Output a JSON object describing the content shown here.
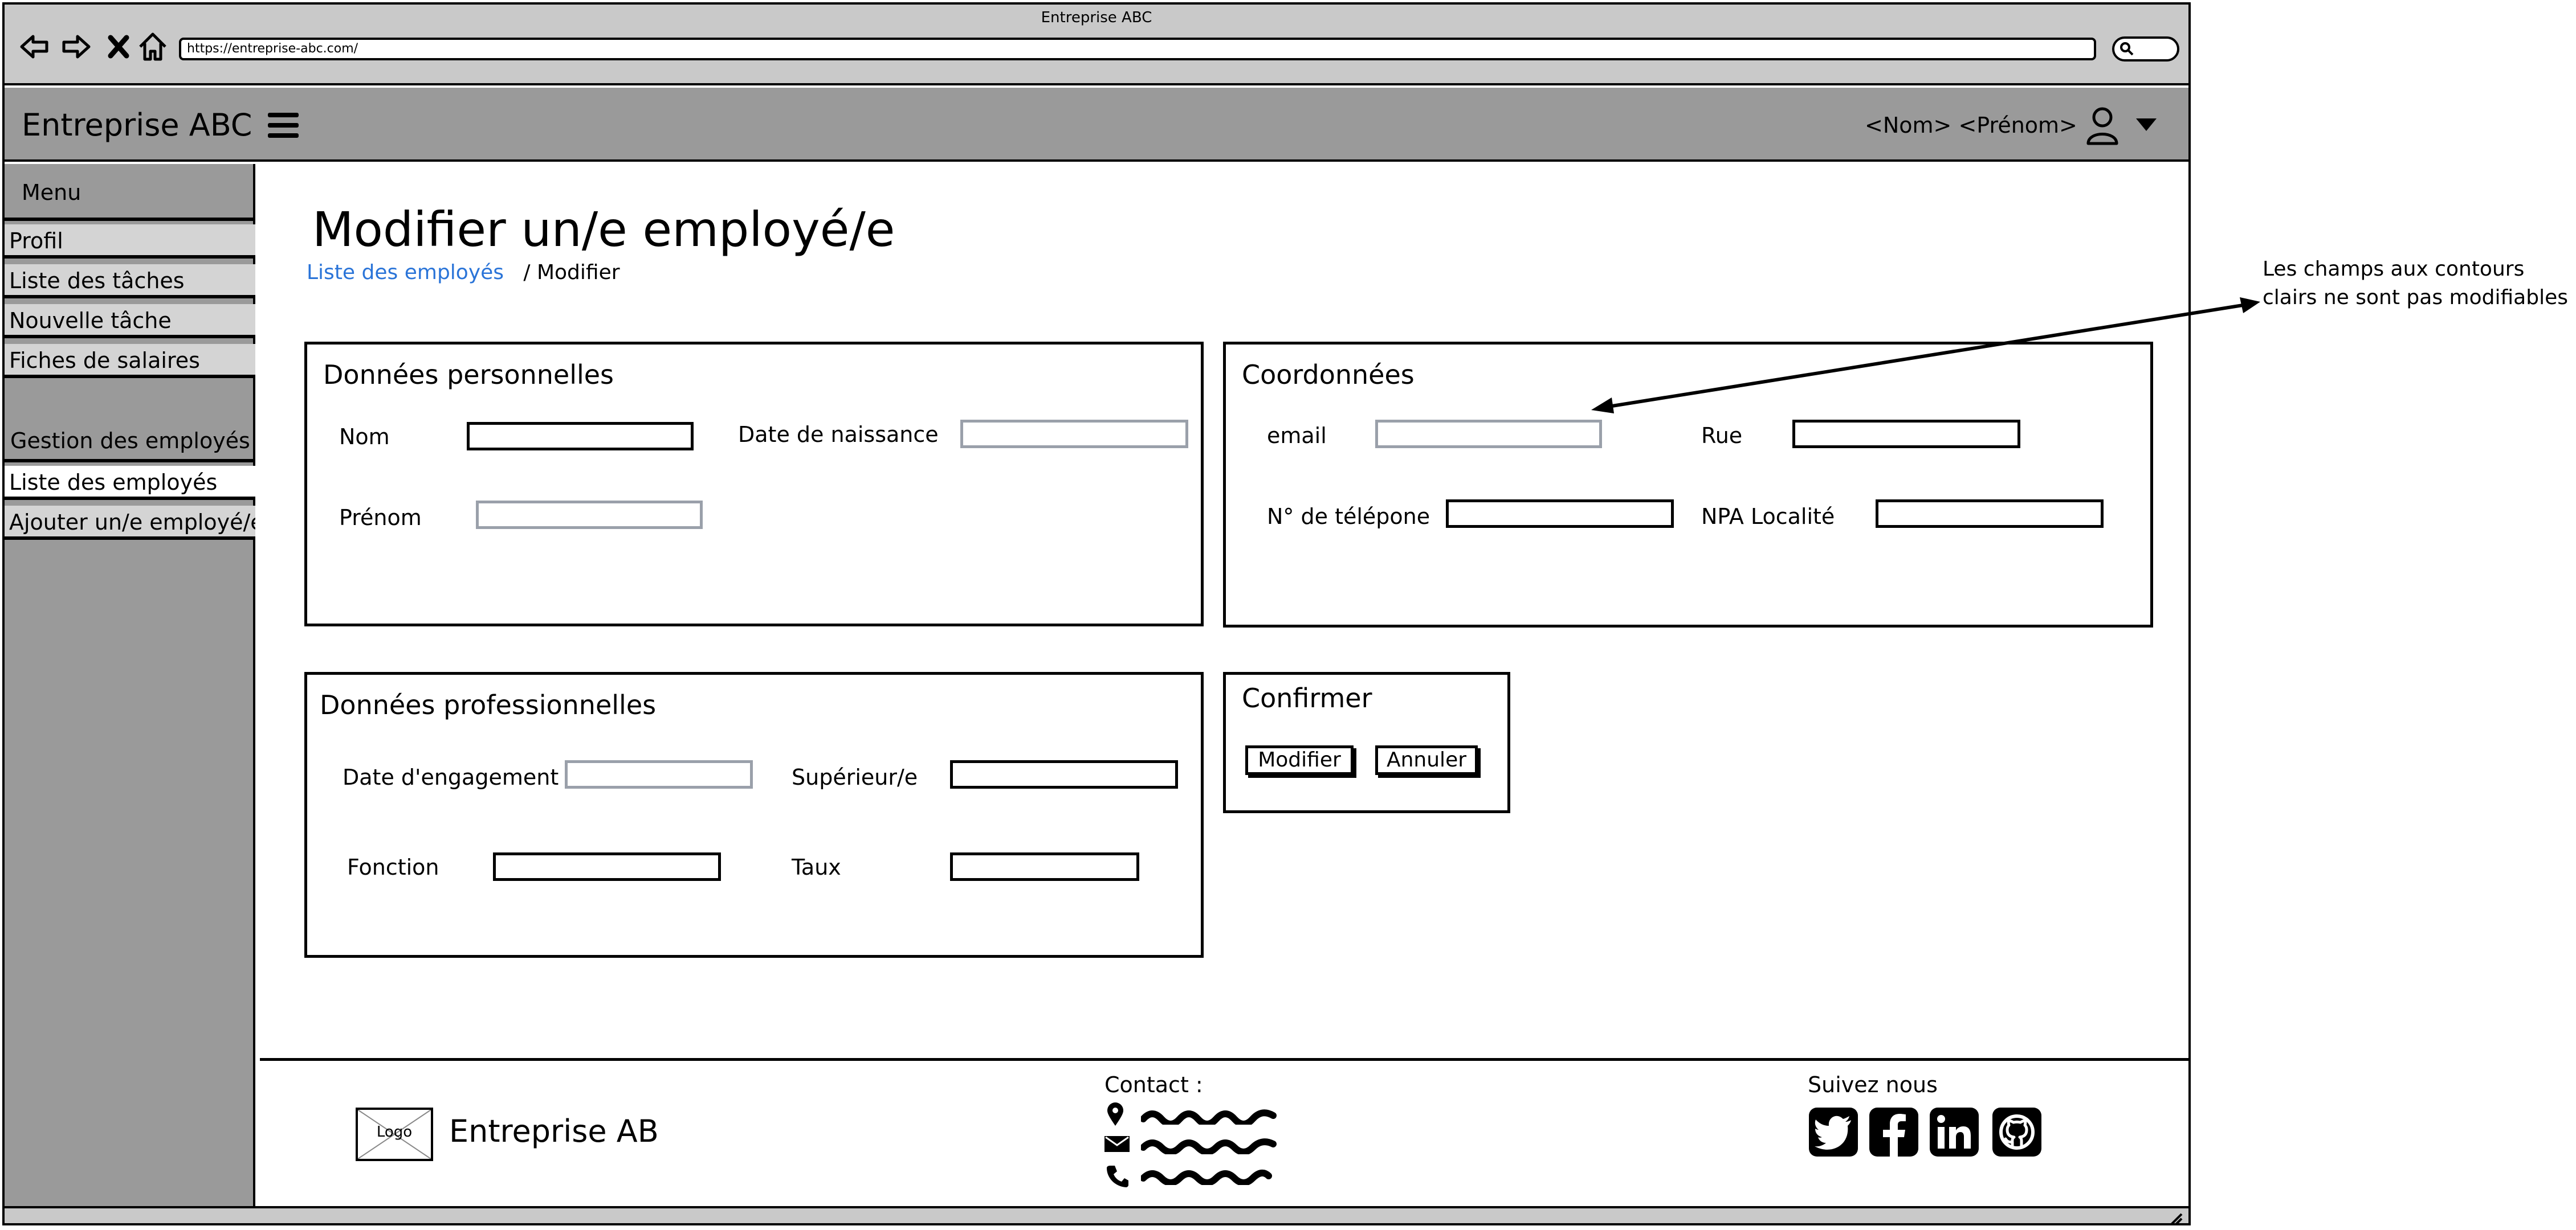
{
  "browser": {
    "window_title": "Entreprise ABC",
    "url": "https://entreprise-abc.com/"
  },
  "header": {
    "brand": "Entreprise ABC",
    "user_name": "<Nom> <Prénom>"
  },
  "sidebar": {
    "menu_title": "Menu",
    "items": [
      {
        "label": "Profil"
      },
      {
        "label": "Liste des tâches"
      },
      {
        "label": "Nouvelle tâche"
      },
      {
        "label": "Fiches de salaires"
      }
    ],
    "section_title": "Gestion des employés",
    "section_items": [
      {
        "label": "Liste des employés"
      },
      {
        "label": "Ajouter un/e employé/e"
      }
    ]
  },
  "main": {
    "title": "Modifier un/e employé/e",
    "breadcrumb": {
      "link": "Liste des employés",
      "current": "/ Modifier"
    },
    "personal": {
      "title": "Données personnelles",
      "nom_label": "Nom",
      "naissance_label": "Date de naissance",
      "prenom_label": "Prénom"
    },
    "contact": {
      "title": "Coordonnées",
      "email_label": "email",
      "rue_label": "Rue",
      "tel_label": "N° de télépone",
      "npa_label": "NPA Localité"
    },
    "professional": {
      "title": "Données professionnelles",
      "engagement_label": "Date d'engagement",
      "superieur_label": "Supérieur/e",
      "fonction_label": "Fonction",
      "taux_label": "Taux"
    },
    "confirm": {
      "title": "Confirmer",
      "modify_label": "Modifier",
      "cancel_label": "Annuler"
    }
  },
  "annotation": {
    "line1": "Les champs aux contours",
    "line2": "clairs ne sont pas modifiables"
  },
  "footer": {
    "logo_label": "Logo",
    "brand": "Entreprise AB",
    "contact_title": "Contact :",
    "follow_title": "Suivez nous",
    "social": [
      "twitter-icon",
      "facebook-icon",
      "linkedin-icon",
      "github-icon"
    ]
  }
}
